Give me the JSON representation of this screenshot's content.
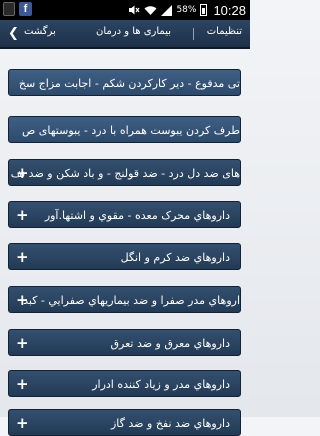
{
  "status_bar": {
    "battery_percent": "58%",
    "time": "10:28"
  },
  "action_bar": {
    "back_label": "برگشت",
    "title": "بیماری ها و درمان",
    "settings_label": "تنظیمات"
  },
  "list_items": [
    {
      "label": "تی مدفوع - دیر کارکردن شکم - اجابت مزاج سخ"
    },
    {
      "label": "طرف کردن یبوست همراه با درد - یبوستهای ص"
    },
    {
      "label": "های ضد دل درد - ضد قولنج - و باد شکن و ضد نف"
    },
    {
      "label": "داروهاي محرک معده - مقوي و اشتها.آور"
    },
    {
      "label": "داروهاي ضد کرم و انگل"
    },
    {
      "label": "اروهاي مدر صفرا و ضد بيماريهاي صفرايي - کبد"
    },
    {
      "label": "داروهاي معرق و ضد تعرق"
    },
    {
      "label": "داروهاي مدر و زياد کننده ادرار"
    },
    {
      "label": "داروهاي ضد نفخ و ضد گاز"
    }
  ]
}
